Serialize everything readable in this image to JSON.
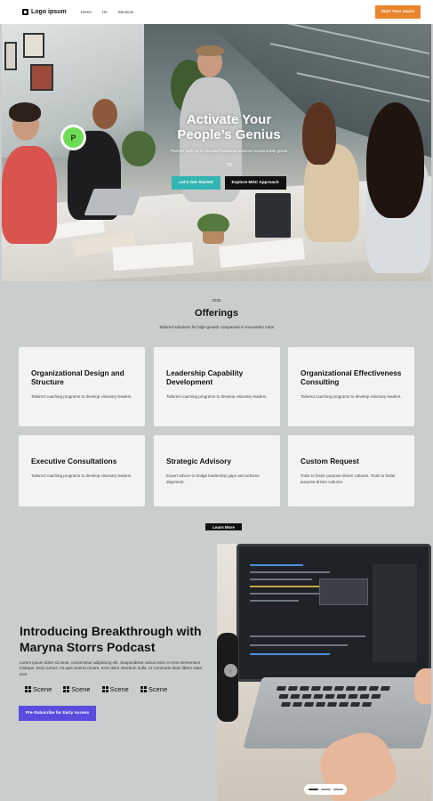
{
  "nav": {
    "logo_text": "Logo ipsum",
    "links": [
      "Home",
      "Us",
      "Services"
    ],
    "cta": "Start Your Journ"
  },
  "hero": {
    "title_line1": "Activate Your",
    "title_line2": "People’s Genius",
    "subtitle": "Partner with us to elevate business achieve measurable goals",
    "tr": "TR",
    "btn_primary": "Let’s Get Started",
    "btn_secondary": "Explore MSC Approach",
    "avatar_letter": "P"
  },
  "offerings": {
    "year": "2025",
    "title": "Offerings",
    "subtitle": "Tailored solutions for high-growth companies in innovation hubs",
    "cards": [
      {
        "title": "Organizational Design and Structure",
        "desc": "Tailored coaching programs to develop visionary leaders."
      },
      {
        "title": "Leadership Capability Development",
        "desc": "Tailored coaching programs to develop visionary leaders."
      },
      {
        "title": "Organizational Effectiveness Consulting",
        "desc": "Tailored coaching programs to develop visionary leaders."
      },
      {
        "title": "Executive Consultations",
        "desc": "Tailored coaching programs to develop visionary leaders."
      },
      {
        "title": "Strategic Advisory",
        "desc": "Expert advice to bridge leadership gaps and achieve alignment."
      },
      {
        "title": "Custom Request",
        "desc": "Tools to foster purpose-driven cultures. Tools to foster purpose-driven cultures."
      }
    ],
    "learn_more": "Learn More"
  },
  "podcast": {
    "title": "Introducing Breakthrough with Maryna Storrs Podcast",
    "desc": "Lorem ipsum dolor sit amet, consectetur adipiscing elit. Suspendisse varius enim in eros elementum tristique. Duis cursus, mi quis viverra ornare, eros dolor interdum nulla, ut commodo diam libero vitae erat.",
    "scenes": [
      "Scene",
      "Scene",
      "Scene",
      "Scene"
    ],
    "subscribe": "Pre-Subscribe for Early Access"
  },
  "colors": {
    "accent_orange": "#e8852d",
    "teal": "#33b5b3",
    "purple": "#5b4ce0",
    "page_bg": "#c9cdcd"
  }
}
